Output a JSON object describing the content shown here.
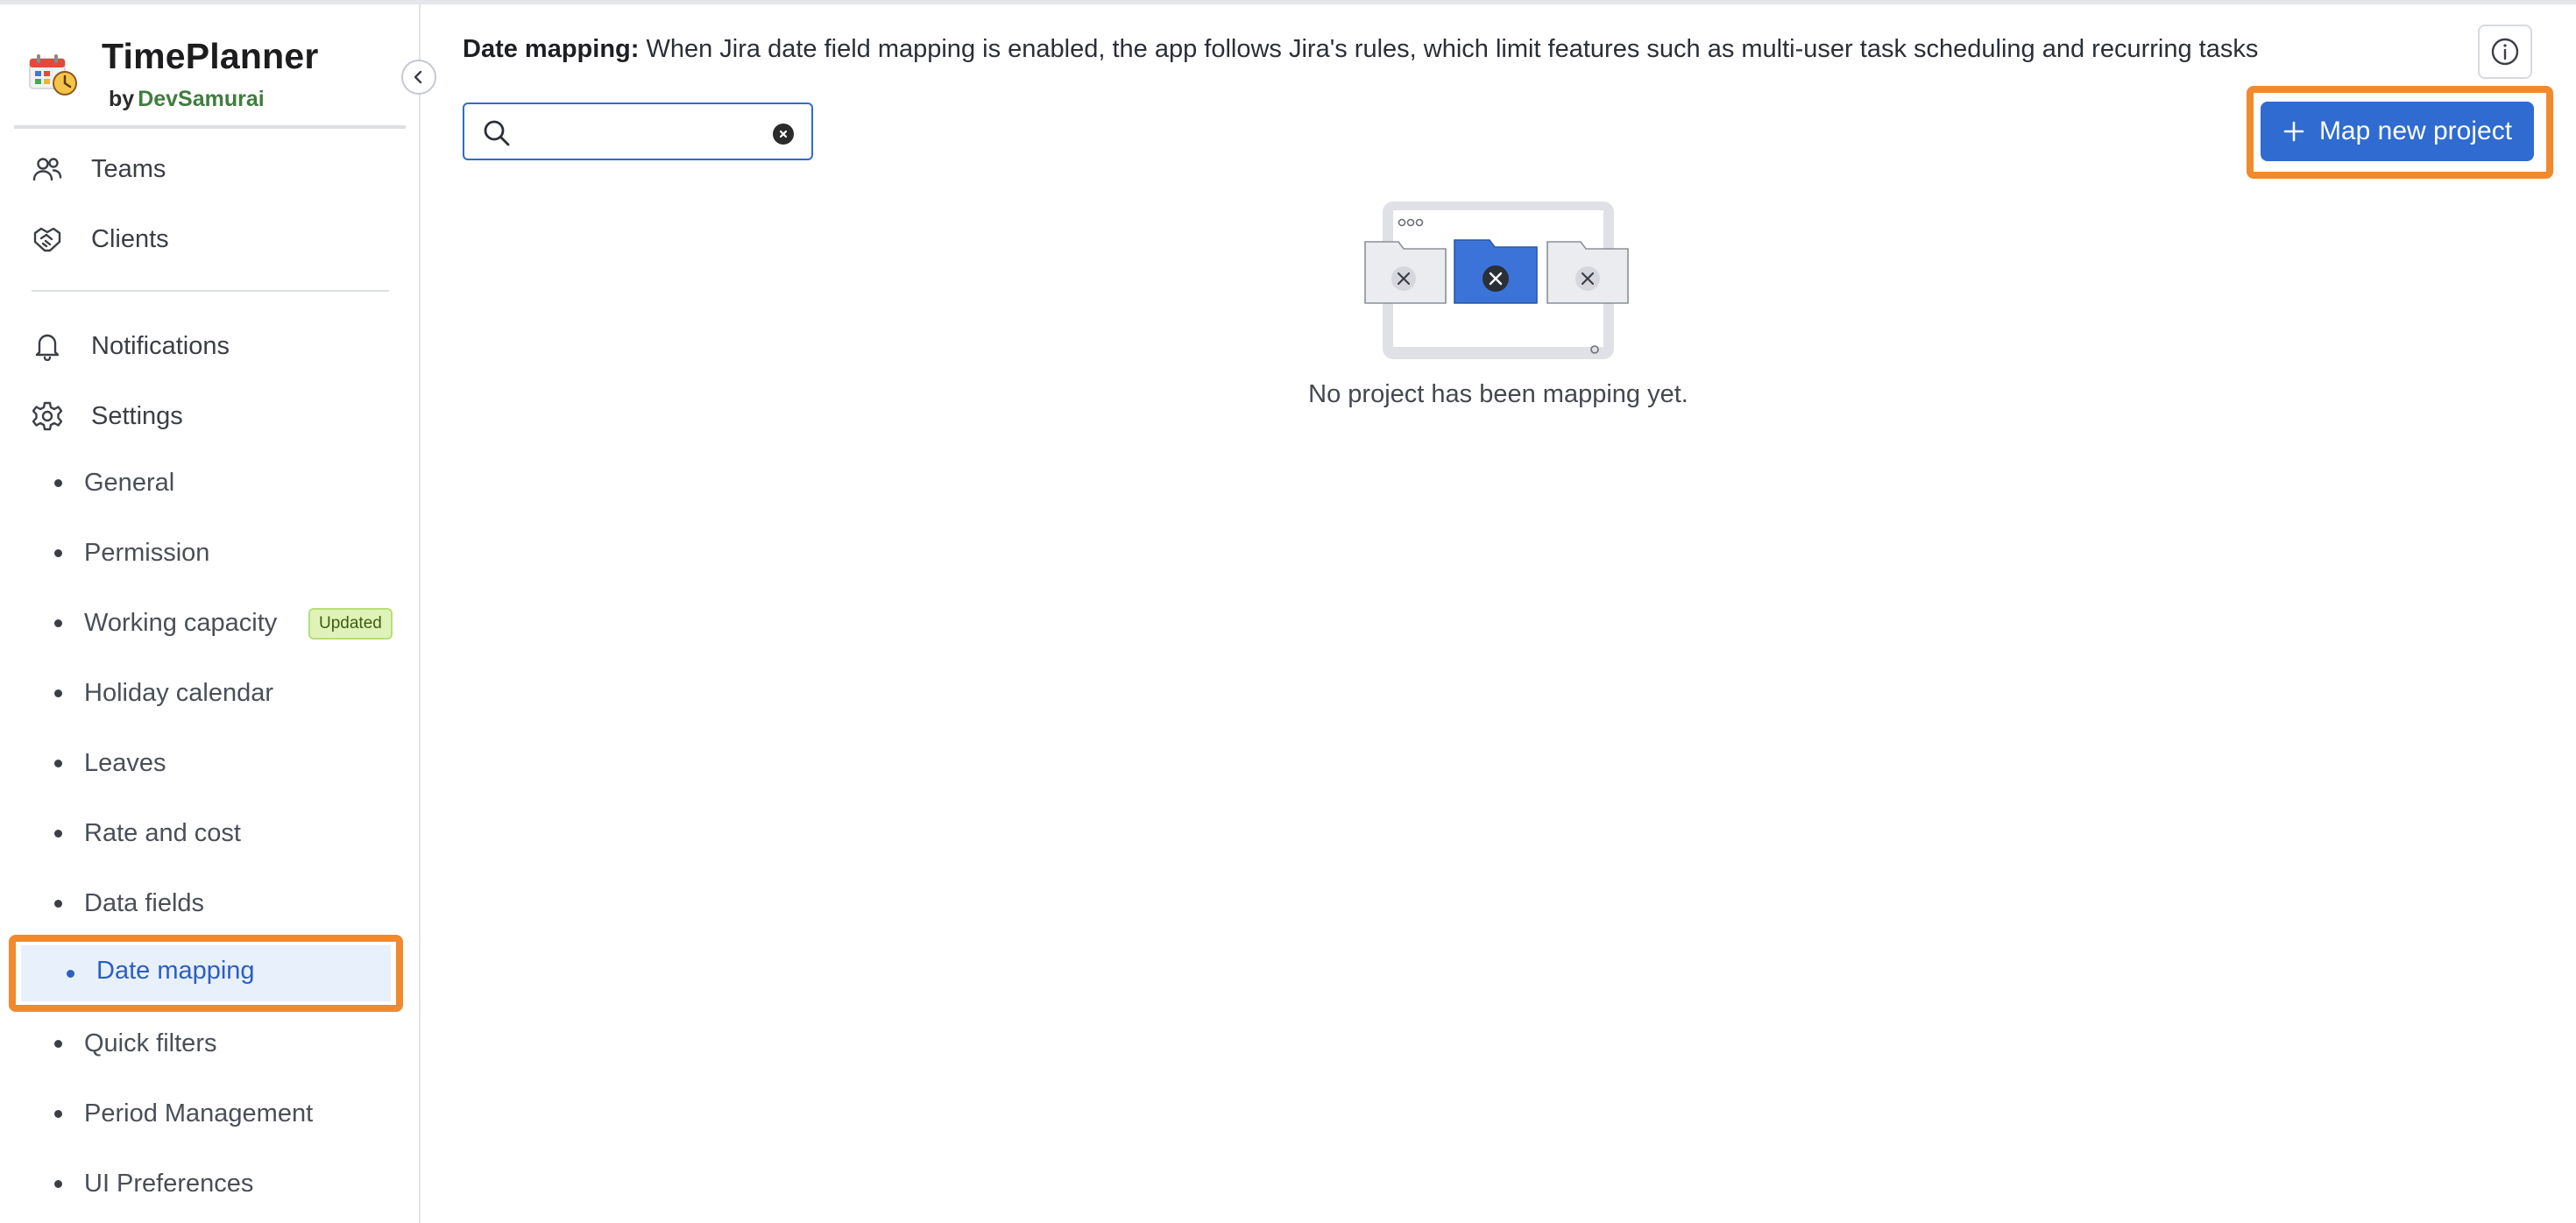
{
  "app": {
    "name": "TimePlanner",
    "by_prefix": "by",
    "maker": "DevSamurai"
  },
  "sidebar": {
    "main_items": [
      {
        "label": "Teams",
        "icon": "people-icon"
      },
      {
        "label": "Clients",
        "icon": "handshake-icon"
      },
      {
        "label": "Notifications",
        "icon": "bell-icon"
      },
      {
        "label": "Settings",
        "icon": "gear-icon"
      }
    ],
    "settings_items": [
      {
        "label": "General"
      },
      {
        "label": "Permission"
      },
      {
        "label": "Working capacity",
        "badge": "Updated"
      },
      {
        "label": "Holiday calendar"
      },
      {
        "label": "Leaves"
      },
      {
        "label": "Rate and cost"
      },
      {
        "label": "Data fields"
      },
      {
        "label": "Date mapping",
        "active": true
      },
      {
        "label": "Quick filters"
      },
      {
        "label": "Period Management"
      },
      {
        "label": "UI Preferences"
      }
    ]
  },
  "notice": {
    "title": "Date mapping:",
    "text": "When Jira date field mapping is enabled, the app follows Jira's rules, which limit features such as multi-user task scheduling and recurring tasks"
  },
  "search": {
    "value": "",
    "placeholder": ""
  },
  "actions": {
    "map_new_project": "Map new project"
  },
  "empty_state": {
    "message": "No project has been mapping yet."
  },
  "colors": {
    "primary": "#2f6bd0",
    "highlight": "#f18a2d",
    "badge_bg": "#dff3b8",
    "active_bg": "#e8f0fc"
  }
}
